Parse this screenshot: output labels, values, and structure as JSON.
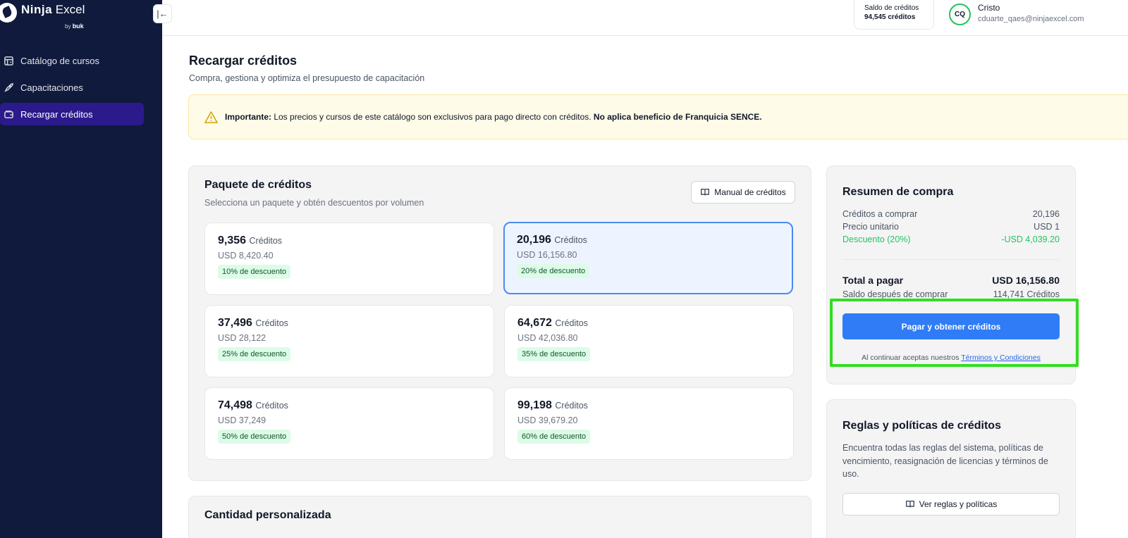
{
  "app": {
    "brand_bold": "Ninja",
    "brand_light": "Excel",
    "brand_by": "by",
    "brand_buk": "buk"
  },
  "sidebar": {
    "items": [
      {
        "label": "Catálogo de cursos",
        "icon": "store-icon"
      },
      {
        "label": "Capacitaciones",
        "icon": "rocket-icon"
      },
      {
        "label": "Recargar créditos",
        "icon": "wallet-icon",
        "active": true
      }
    ]
  },
  "topbar": {
    "balance_label": "Saldo de créditos",
    "balance_value": "94,545 créditos",
    "avatar_initials": "CQ",
    "user_name": "Cristo",
    "user_email": "cduarte_qaes@ninjaexcel.com"
  },
  "page": {
    "title": "Recargar créditos",
    "subtitle": "Compra, gestiona y optimiza el presupuesto de capacitación"
  },
  "alert": {
    "bold_prefix": "Importante:",
    "text": " Los precios y cursos de este catálogo son exclusivos para pago directo con créditos. ",
    "bold_suffix": "No aplica beneficio de Franquicia SENCE."
  },
  "packages": {
    "title": "Paquete de créditos",
    "subtitle": "Selecciona un paquete y obtén descuentos por volumen",
    "manual_label": "Manual de créditos",
    "unit_label": "Créditos",
    "items": [
      {
        "amount": "9,356",
        "price": "USD 8,420.40",
        "discount": "10% de descuento"
      },
      {
        "amount": "20,196",
        "price": "USD 16,156.80",
        "discount": "20% de descuento",
        "selected": true
      },
      {
        "amount": "37,496",
        "price": "USD 28,122",
        "discount": "25% de descuento"
      },
      {
        "amount": "64,672",
        "price": "USD 42,036.80",
        "discount": "35% de descuento"
      },
      {
        "amount": "74,498",
        "price": "USD 37,249",
        "discount": "50% de descuento"
      },
      {
        "amount": "99,198",
        "price": "USD 39,679.20",
        "discount": "60% de descuento"
      }
    ]
  },
  "summary": {
    "title": "Resumen de compra",
    "rows": [
      {
        "label": "Créditos a comprar",
        "value": "20,196"
      },
      {
        "label": "Precio unitario",
        "value": "USD 1"
      },
      {
        "label": "Descuento (20%)",
        "value": "-USD 4,039.20"
      }
    ],
    "total_label": "Total a pagar",
    "total_value": "USD 16,156.80",
    "after_label": "Saldo después de comprar",
    "after_value": "114,741 Créditos",
    "pay_label": "Pagar y obtener créditos",
    "terms_text": "Al continuar aceptas nuestros ",
    "terms_link": "Términos y Condiciones"
  },
  "rules": {
    "title": "Reglas y políticas de créditos",
    "text": "Encuentra todas las reglas del sistema, políticas de vencimiento, reasignación de licencias y términos de uso.",
    "button_label": "Ver reglas y políticas"
  },
  "custom": {
    "title": "Cantidad personalizada"
  },
  "colors": {
    "sidebar": "#0f1a3d",
    "active": "#2b1a8c",
    "primary": "#2f7cf6",
    "success": "#22c55e",
    "highlight": "#33dd22"
  }
}
